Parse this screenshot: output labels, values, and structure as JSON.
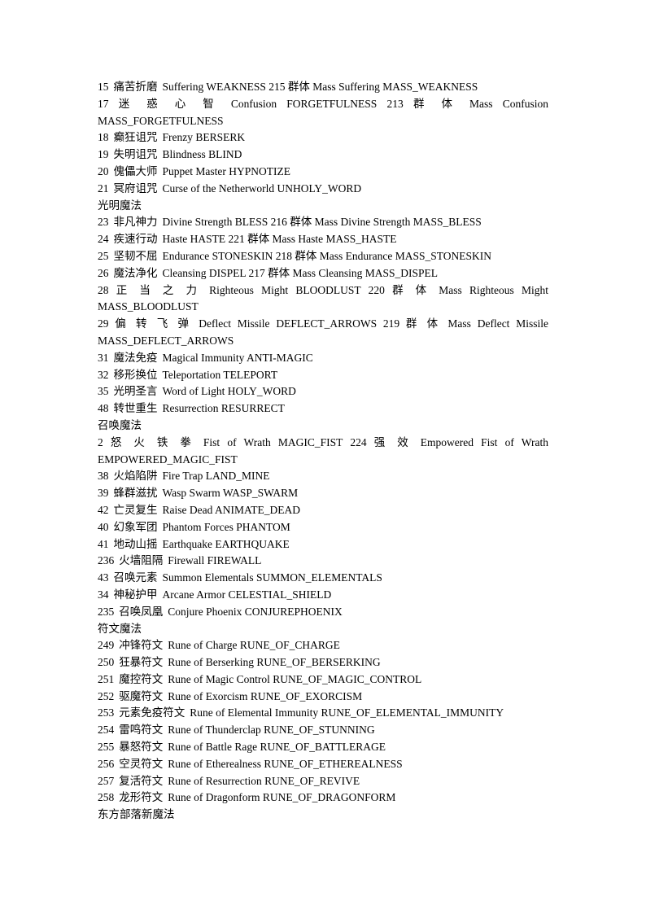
{
  "document": {
    "lines": [
      {
        "type": "entry",
        "id": "15",
        "cn": "痛苦折磨",
        "en": "Suffering WEAKNESS 215 群体 Mass Suffering MASS_WEAKNESS"
      },
      {
        "type": "wrapped",
        "first": "17　迷 惑 心 智　Confusion　FORGETFULNESS　213　群 体　Mass　Confusion",
        "second": "MASS_FORGETFULNESS"
      },
      {
        "type": "entry",
        "id": "18",
        "cn": "癫狂诅咒",
        "en": "Frenzy BERSERK"
      },
      {
        "type": "entry",
        "id": "19",
        "cn": "失明诅咒",
        "en": "Blindness BLIND"
      },
      {
        "type": "entry",
        "id": "20",
        "cn": "傀儡大师",
        "en": "Puppet Master HYPNOTIZE"
      },
      {
        "type": "entry",
        "id": "21",
        "cn": "冥府诅咒",
        "en": "Curse of the Netherworld UNHOLY_WORD"
      },
      {
        "type": "heading",
        "text": "光明魔法"
      },
      {
        "type": "entry",
        "id": "23",
        "cn": "非凡神力",
        "en": "Divine Strength BLESS 216 群体 Mass Divine Strength MASS_BLESS"
      },
      {
        "type": "entry",
        "id": "24",
        "cn": "疾速行动",
        "en": "Haste HASTE 221 群体 Mass Haste MASS_HASTE"
      },
      {
        "type": "entry",
        "id": "25",
        "cn": "坚韧不屈",
        "en": "Endurance STONESKIN 218 群体 Mass Endurance MASS_STONESKIN"
      },
      {
        "type": "entry",
        "id": "26",
        "cn": "魔法净化",
        "en": "Cleansing DISPEL 217 群体 Mass Cleansing MASS_DISPEL"
      },
      {
        "type": "wrapped",
        "first": "28　正 当 之 力　Righteous　Might　BLOODLUST　220　群 体　Mass　Righteous　Might",
        "second": "MASS_BLOODLUST"
      },
      {
        "type": "wrapped",
        "first": "29　偏 转 飞 弹　Deflect　Missile　DEFLECT_ARROWS　219　群 体　Mass　Deflect　Missile",
        "second": "MASS_DEFLECT_ARROWS"
      },
      {
        "type": "entry",
        "id": "31",
        "cn": "魔法免疫",
        "en": "Magical Immunity ANTI-MAGIC"
      },
      {
        "type": "entry",
        "id": "32",
        "cn": "移形换位",
        "en": "Teleportation TELEPORT"
      },
      {
        "type": "entry",
        "id": "35",
        "cn": "光明圣言",
        "en": "Word of Light HOLY_WORD"
      },
      {
        "type": "entry",
        "id": "48",
        "cn": "转世重生",
        "en": "Resurrection RESURRECT"
      },
      {
        "type": "heading",
        "text": "召唤魔法"
      },
      {
        "type": "wrapped",
        "first": "2　怒 火 铁 拳　Fist　of　Wrath　MAGIC_FIST　224　强 效　Empowered　Fist　of　Wrath",
        "second": "EMPOWERED_MAGIC_FIST"
      },
      {
        "type": "entry",
        "id": "38",
        "cn": "火焰陷阱",
        "en": "Fire Trap LAND_MINE"
      },
      {
        "type": "entry",
        "id": "39",
        "cn": "蜂群滋扰",
        "en": "Wasp Swarm WASP_SWARM"
      },
      {
        "type": "entry",
        "id": "42",
        "cn": "亡灵复生",
        "en": "Raise Dead ANIMATE_DEAD"
      },
      {
        "type": "entry",
        "id": "40",
        "cn": "幻象军团",
        "en": "Phantom Forces PHANTOM"
      },
      {
        "type": "entry",
        "id": "41",
        "cn": "地动山摇",
        "en": "Earthquake EARTHQUAKE"
      },
      {
        "type": "entry",
        "id": "236",
        "cn": "火墙阻隔",
        "en": "Firewall FIREWALL"
      },
      {
        "type": "entry",
        "id": "43",
        "cn": "召唤元素",
        "en": "Summon Elementals SUMMON_ELEMENTALS"
      },
      {
        "type": "entry",
        "id": "34",
        "cn": "神秘护甲",
        "en": "Arcane Armor CELESTIAL_SHIELD"
      },
      {
        "type": "entry",
        "id": "235",
        "cn": "召唤凤凰",
        "en": "Conjure Phoenix CONJUREPHOENIX"
      },
      {
        "type": "heading",
        "text": "符文魔法"
      },
      {
        "type": "entry",
        "id": "249",
        "cn": "冲锋符文",
        "en": "Rune of Charge RUNE_OF_CHARGE"
      },
      {
        "type": "entry",
        "id": "250",
        "cn": "狂暴符文",
        "en": "Rune of Berserking RUNE_OF_BERSERKING"
      },
      {
        "type": "entry",
        "id": "251",
        "cn": "魔控符文",
        "en": "Rune of Magic Control RUNE_OF_MAGIC_CONTROL"
      },
      {
        "type": "entry",
        "id": "252",
        "cn": "驱魔符文",
        "en": "Rune of Exorcism RUNE_OF_EXORCISM"
      },
      {
        "type": "entry",
        "id": "253",
        "cn": "元素免疫符文",
        "en": "Rune of Elemental Immunity RUNE_OF_ELEMENTAL_IMMUNITY"
      },
      {
        "type": "entry",
        "id": "254",
        "cn": "雷鸣符文",
        "en": "Rune of Thunderclap RUNE_OF_STUNNING"
      },
      {
        "type": "entry",
        "id": "255",
        "cn": "暴怒符文",
        "en": "Rune of Battle Rage RUNE_OF_BATTLERAGE"
      },
      {
        "type": "entry",
        "id": "256",
        "cn": "空灵符文",
        "en": "Rune of Etherealness RUNE_OF_ETHEREALNESS"
      },
      {
        "type": "entry",
        "id": "257",
        "cn": "复活符文",
        "en": "Rune of Resurrection RUNE_OF_REVIVE"
      },
      {
        "type": "entry",
        "id": "258",
        "cn": "龙形符文",
        "en": "Rune of Dragonform RUNE_OF_DRAGONFORM"
      },
      {
        "type": "heading",
        "text": "东方部落新魔法"
      }
    ]
  }
}
